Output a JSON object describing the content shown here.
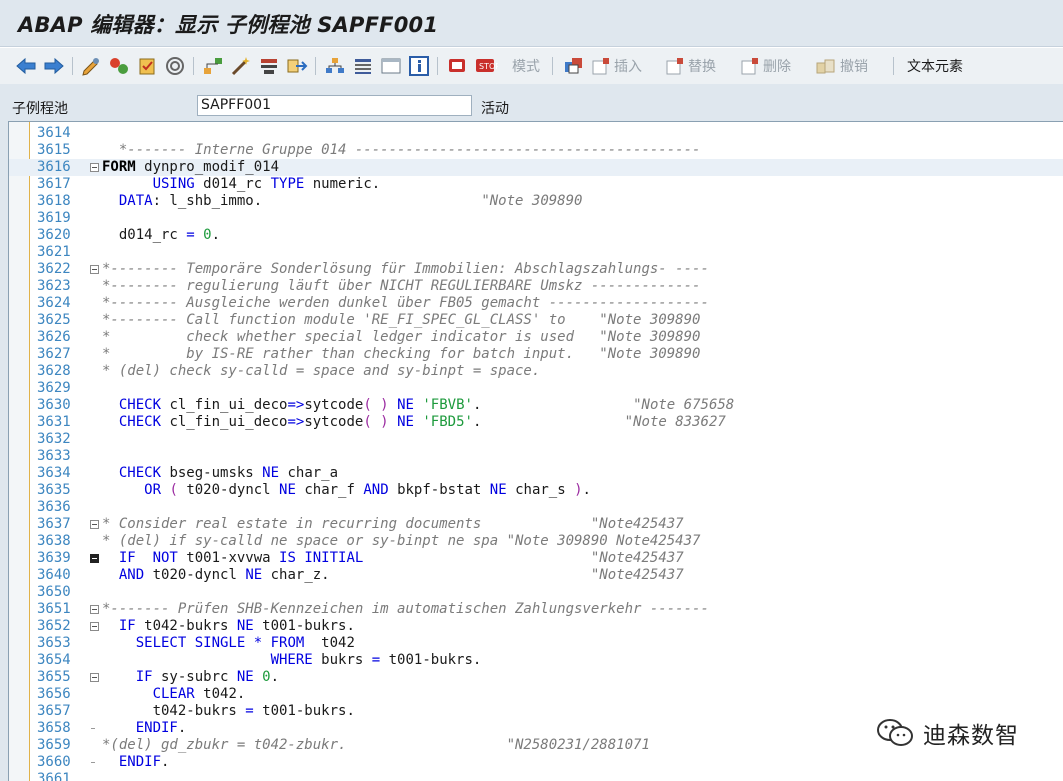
{
  "window": {
    "title": "ABAP 编辑器：显示 子例程池 SAPFF001"
  },
  "toolbar": {
    "mode_label": "模式",
    "insert_label": "插入",
    "replace_label": "替换",
    "delete_label": "删除",
    "undo_label": "撤销",
    "text_elements_label": "文本元素"
  },
  "fields": {
    "program_label": "子例程池",
    "program_value": "SAPFF001",
    "status": "活动"
  },
  "editor": {
    "lines": [
      {
        "no": "3614",
        "tokens": []
      },
      {
        "no": "3615",
        "tokens": [
          {
            "t": "c",
            "v": "  *------- Interne Gruppe 014 -----------------------------------------"
          }
        ]
      },
      {
        "no": "3616",
        "fold": "open",
        "current": true,
        "tokens": [
          {
            "t": "kb",
            "v": "FORM"
          },
          {
            "t": "x",
            "v": " dynpro_modif_014"
          }
        ]
      },
      {
        "no": "3617",
        "tokens": [
          {
            "t": "x",
            "v": "      "
          },
          {
            "t": "k",
            "v": "USING"
          },
          {
            "t": "x",
            "v": " d014_rc "
          },
          {
            "t": "k",
            "v": "TYPE"
          },
          {
            "t": "x",
            "v": " numeric."
          }
        ]
      },
      {
        "no": "3618",
        "tokens": [
          {
            "t": "x",
            "v": "  "
          },
          {
            "t": "k",
            "v": "DATA"
          },
          {
            "t": "x",
            "v": ": l_shb_immo.                          "
          },
          {
            "t": "c",
            "v": "\"Note 309890"
          }
        ]
      },
      {
        "no": "3619",
        "tokens": []
      },
      {
        "no": "3620",
        "tokens": [
          {
            "t": "x",
            "v": "  d014_rc "
          },
          {
            "t": "k",
            "v": "="
          },
          {
            "t": "x",
            "v": " "
          },
          {
            "t": "n",
            "v": "0"
          },
          {
            "t": "x",
            "v": "."
          }
        ]
      },
      {
        "no": "3621",
        "tokens": []
      },
      {
        "no": "3622",
        "fold": "open",
        "tokens": [
          {
            "t": "c",
            "v": "*-------- Temporäre Sonderlösung für Immobilien: Abschlagszahlungs- ----"
          }
        ]
      },
      {
        "no": "3623",
        "fold": "line",
        "tokens": [
          {
            "t": "c",
            "v": "*-------- regulierung läuft über NICHT REGULIERBARE Umskz -------------"
          }
        ]
      },
      {
        "no": "3624",
        "fold": "line",
        "tokens": [
          {
            "t": "c",
            "v": "*-------- Ausgleiche werden dunkel über FB05 gemacht -------------------"
          }
        ]
      },
      {
        "no": "3625",
        "fold": "line",
        "tokens": [
          {
            "t": "c",
            "v": "*-------- Call function module 'RE_FI_SPEC_GL_CLASS' to    \"Note 309890"
          }
        ]
      },
      {
        "no": "3626",
        "fold": "line",
        "tokens": [
          {
            "t": "c",
            "v": "*         check whether special ledger indicator is used   \"Note 309890"
          }
        ]
      },
      {
        "no": "3627",
        "fold": "line",
        "tokens": [
          {
            "t": "c",
            "v": "*         by IS-RE rather than checking for batch input.   \"Note 309890"
          }
        ]
      },
      {
        "no": "3628",
        "fold": "line",
        "tokens": [
          {
            "t": "c",
            "v": "* (del) check sy-calld = space and sy-binpt = space."
          }
        ]
      },
      {
        "no": "3629",
        "tokens": []
      },
      {
        "no": "3630",
        "tokens": [
          {
            "t": "x",
            "v": "  "
          },
          {
            "t": "k",
            "v": "CHECK"
          },
          {
            "t": "x",
            "v": " cl_fin_ui_deco"
          },
          {
            "t": "k",
            "v": "=>"
          },
          {
            "t": "x",
            "v": "sytcode"
          },
          {
            "t": "p",
            "v": "( )"
          },
          {
            "t": "x",
            "v": " "
          },
          {
            "t": "k",
            "v": "NE"
          },
          {
            "t": "x",
            "v": " "
          },
          {
            "t": "s",
            "v": "'FBVB'"
          },
          {
            "t": "x",
            "v": ".                  "
          },
          {
            "t": "c",
            "v": "\"Note 675658"
          }
        ]
      },
      {
        "no": "3631",
        "tokens": [
          {
            "t": "x",
            "v": "  "
          },
          {
            "t": "k",
            "v": "CHECK"
          },
          {
            "t": "x",
            "v": " cl_fin_ui_deco"
          },
          {
            "t": "k",
            "v": "=>"
          },
          {
            "t": "x",
            "v": "sytcode"
          },
          {
            "t": "p",
            "v": "( )"
          },
          {
            "t": "x",
            "v": " "
          },
          {
            "t": "k",
            "v": "NE"
          },
          {
            "t": "x",
            "v": " "
          },
          {
            "t": "s",
            "v": "'FBD5'"
          },
          {
            "t": "x",
            "v": ".                 "
          },
          {
            "t": "c",
            "v": "\"Note 833627"
          }
        ]
      },
      {
        "no": "3632",
        "tokens": []
      },
      {
        "no": "3633",
        "tokens": []
      },
      {
        "no": "3634",
        "tokens": [
          {
            "t": "x",
            "v": "  "
          },
          {
            "t": "k",
            "v": "CHECK"
          },
          {
            "t": "x",
            "v": " bseg-umsks "
          },
          {
            "t": "k",
            "v": "NE"
          },
          {
            "t": "x",
            "v": " char_a"
          }
        ]
      },
      {
        "no": "3635",
        "tokens": [
          {
            "t": "x",
            "v": "     "
          },
          {
            "t": "k",
            "v": "OR"
          },
          {
            "t": "x",
            "v": " "
          },
          {
            "t": "p",
            "v": "("
          },
          {
            "t": "x",
            "v": " t020-dyncl "
          },
          {
            "t": "k",
            "v": "NE"
          },
          {
            "t": "x",
            "v": " char_f "
          },
          {
            "t": "k",
            "v": "AND"
          },
          {
            "t": "x",
            "v": " bkpf-bstat "
          },
          {
            "t": "k",
            "v": "NE"
          },
          {
            "t": "x",
            "v": " char_s "
          },
          {
            "t": "p",
            "v": ")"
          },
          {
            "t": "x",
            "v": "."
          }
        ]
      },
      {
        "no": "3636",
        "tokens": []
      },
      {
        "no": "3637",
        "fold": "open",
        "tokens": [
          {
            "t": "c",
            "v": "* Consider real estate in recurring documents             \"Note425437"
          }
        ]
      },
      {
        "no": "3638",
        "fold": "line",
        "tokens": [
          {
            "t": "c",
            "v": "* (del) if sy-calld ne space or sy-binpt ne spa \"Note 309890 Note425437"
          }
        ]
      },
      {
        "no": "3639",
        "fold": "plus",
        "tokens": [
          {
            "t": "x",
            "v": "  "
          },
          {
            "t": "k",
            "v": "IF"
          },
          {
            "t": "x",
            "v": "  "
          },
          {
            "t": "k",
            "v": "NOT"
          },
          {
            "t": "x",
            "v": " t001-xvvwa "
          },
          {
            "t": "k",
            "v": "IS INITIAL"
          },
          {
            "t": "x",
            "v": "                           "
          },
          {
            "t": "c",
            "v": "\"Note425437"
          }
        ]
      },
      {
        "no": "3640",
        "fold": "line",
        "tokens": [
          {
            "t": "x",
            "v": "  "
          },
          {
            "t": "k",
            "v": "AND"
          },
          {
            "t": "x",
            "v": " t020-dyncl "
          },
          {
            "t": "k",
            "v": "NE"
          },
          {
            "t": "x",
            "v": " char_z.                               "
          },
          {
            "t": "c",
            "v": "\"Note425437"
          }
        ]
      },
      {
        "no": "3650",
        "tokens": []
      },
      {
        "no": "3651",
        "fold": "open",
        "tokens": [
          {
            "t": "c",
            "v": "*------- Prüfen SHB-Kennzeichen im automatischen Zahlungsverkehr -------"
          }
        ]
      },
      {
        "no": "3652",
        "fold": "open",
        "tokens": [
          {
            "t": "x",
            "v": "  "
          },
          {
            "t": "k",
            "v": "IF"
          },
          {
            "t": "x",
            "v": " t042-bukrs "
          },
          {
            "t": "k",
            "v": "NE"
          },
          {
            "t": "x",
            "v": " t001-bukrs."
          }
        ]
      },
      {
        "no": "3653",
        "fold": "line",
        "tokens": [
          {
            "t": "x",
            "v": "    "
          },
          {
            "t": "k",
            "v": "SELECT SINGLE"
          },
          {
            "t": "x",
            "v": " "
          },
          {
            "t": "k",
            "v": "*"
          },
          {
            "t": "x",
            "v": " "
          },
          {
            "t": "k",
            "v": "FROM"
          },
          {
            "t": "x",
            "v": "  t042"
          }
        ]
      },
      {
        "no": "3654",
        "fold": "line",
        "tokens": [
          {
            "t": "x",
            "v": "                    "
          },
          {
            "t": "k",
            "v": "WHERE"
          },
          {
            "t": "x",
            "v": " bukrs "
          },
          {
            "t": "k",
            "v": "="
          },
          {
            "t": "x",
            "v": " t001-bukrs."
          }
        ]
      },
      {
        "no": "3655",
        "fold": "open",
        "tokens": [
          {
            "t": "x",
            "v": "    "
          },
          {
            "t": "k",
            "v": "IF"
          },
          {
            "t": "x",
            "v": " sy-subrc "
          },
          {
            "t": "k",
            "v": "NE"
          },
          {
            "t": "x",
            "v": " "
          },
          {
            "t": "n",
            "v": "0"
          },
          {
            "t": "x",
            "v": "."
          }
        ]
      },
      {
        "no": "3656",
        "fold": "line",
        "tokens": [
          {
            "t": "x",
            "v": "      "
          },
          {
            "t": "k",
            "v": "CLEAR"
          },
          {
            "t": "x",
            "v": " t042."
          }
        ]
      },
      {
        "no": "3657",
        "fold": "line",
        "tokens": [
          {
            "t": "x",
            "v": "      t042-bukrs "
          },
          {
            "t": "k",
            "v": "="
          },
          {
            "t": "x",
            "v": " t001-bukrs."
          }
        ]
      },
      {
        "no": "3658",
        "fold": "end",
        "tokens": [
          {
            "t": "x",
            "v": "    "
          },
          {
            "t": "k",
            "v": "ENDIF"
          },
          {
            "t": "x",
            "v": "."
          }
        ]
      },
      {
        "no": "3659",
        "fold": "line",
        "tokens": [
          {
            "t": "c",
            "v": "*(del) gd_zbukr = t042-zbukr.                   \"N2580231/2881071"
          }
        ]
      },
      {
        "no": "3660",
        "fold": "end",
        "tokens": [
          {
            "t": "x",
            "v": "  "
          },
          {
            "t": "k",
            "v": "ENDIF"
          },
          {
            "t": "x",
            "v": "."
          }
        ]
      },
      {
        "no": "3661",
        "tokens": []
      }
    ]
  },
  "watermark": {
    "text": "迪森数智"
  },
  "colors": {
    "keyword": "#0000e0",
    "comment": "#7b7b7b",
    "string": "#1d9a3c",
    "line_number": "#3d86c0"
  }
}
